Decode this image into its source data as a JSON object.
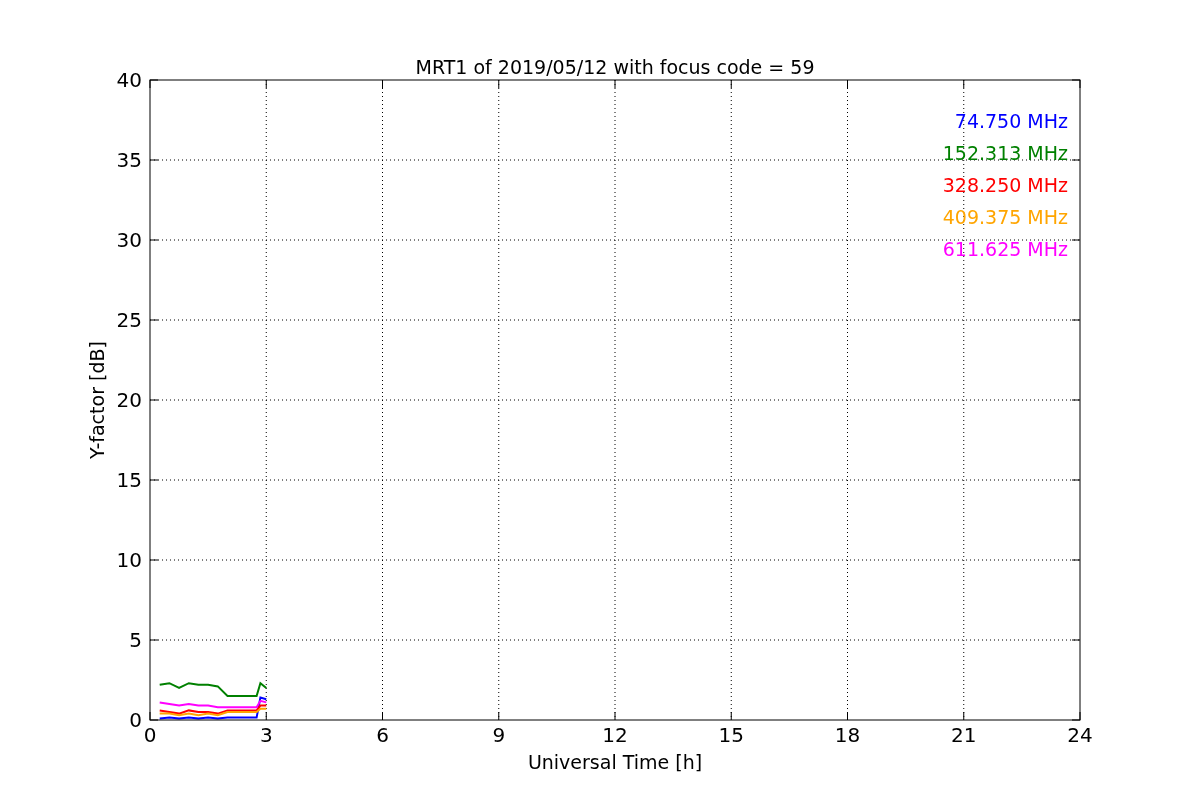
{
  "chart_data": {
    "type": "line",
    "title": "MRT1 of 2019/05/12 with focus code = 59",
    "xlabel": "Universal Time [h]",
    "ylabel": "Y-factor [dB]",
    "x": [
      0.25,
      0.5,
      0.75,
      1.0,
      1.25,
      1.5,
      1.75,
      2.0,
      2.5,
      2.75,
      2.85,
      3.0
    ],
    "xlim": [
      0,
      24
    ],
    "ylim": [
      0,
      40
    ],
    "xticks": [
      0,
      3,
      6,
      9,
      12,
      15,
      18,
      21,
      24
    ],
    "grid": true,
    "yticks": [
      0,
      5,
      10,
      15,
      20,
      25,
      30,
      35,
      40
    ],
    "series": [
      {
        "name": "74.750 MHz",
        "color": "#0000ff",
        "values": [
          0.1,
          0.15,
          0.1,
          0.15,
          0.1,
          0.15,
          0.1,
          0.15,
          0.15,
          0.15,
          1.4,
          1.3
        ]
      },
      {
        "name": "152.313 MHz",
        "color": "#008000",
        "values": [
          2.2,
          2.3,
          2.0,
          2.3,
          2.2,
          2.2,
          2.1,
          1.5,
          1.5,
          1.5,
          2.3,
          2.0
        ]
      },
      {
        "name": "328.250 MHz",
        "color": "#ff0000",
        "values": [
          0.6,
          0.5,
          0.4,
          0.6,
          0.5,
          0.5,
          0.4,
          0.6,
          0.6,
          0.6,
          0.9,
          0.9
        ]
      },
      {
        "name": "409.375 MHz",
        "color": "#ffa500",
        "values": [
          0.4,
          0.4,
          0.3,
          0.4,
          0.3,
          0.4,
          0.3,
          0.5,
          0.5,
          0.5,
          0.7,
          0.7
        ]
      },
      {
        "name": "611.625 MHz",
        "color": "#ff00ff",
        "values": [
          1.1,
          1.0,
          0.9,
          1.0,
          0.9,
          0.9,
          0.8,
          0.8,
          0.8,
          0.8,
          1.2,
          1.1
        ]
      }
    ]
  }
}
